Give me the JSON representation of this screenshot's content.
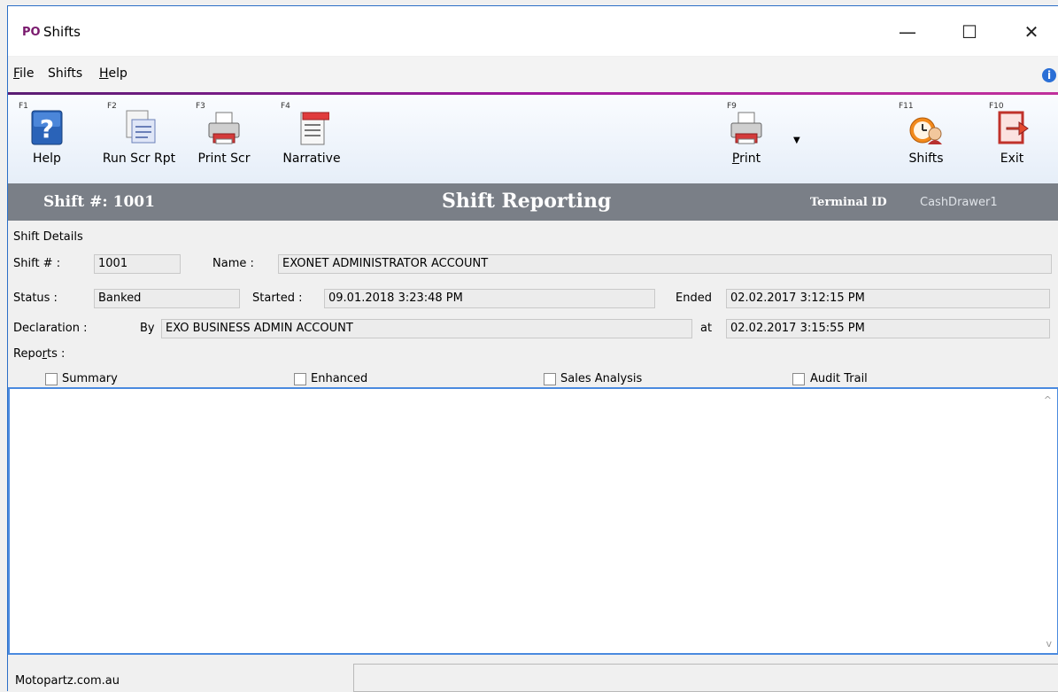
{
  "window": {
    "logo": "PO",
    "title": "Shifts"
  },
  "window_controls": {
    "minimize": "—",
    "maximize": "☐",
    "close": "✕"
  },
  "menu": [
    {
      "label": "File",
      "mnemonic": "F",
      "rest": "ile"
    },
    {
      "label": "Shifts",
      "mnemonic": "",
      "rest": "Shifts"
    },
    {
      "label": "Help",
      "mnemonic": "H",
      "rest": "elp"
    }
  ],
  "info_icon": "i",
  "toolbar": {
    "help": {
      "fkey": "F1",
      "label": "Help",
      "icon": "help-question-icon"
    },
    "run_scr_rpt": {
      "fkey": "F2",
      "label": "Run Scr Rpt",
      "icon": "report-screen-icon"
    },
    "print_scr": {
      "fkey": "F3",
      "label": "Print Scr",
      "icon": "printer-icon"
    },
    "narrative": {
      "fkey": "F4",
      "label": "Narrative",
      "icon": "narrative-document-icon"
    },
    "print": {
      "fkey": "F9",
      "label": "Print",
      "mnemonic": "P",
      "rest": "rint",
      "icon": "printer-icon"
    },
    "shifts": {
      "fkey": "F11",
      "label": "Shifts",
      "icon": "clock-person-icon"
    },
    "exit": {
      "fkey": "F10",
      "label": "Exit",
      "icon": "exit-door-icon"
    }
  },
  "banner": {
    "shift": "Shift #: 1001",
    "title": "Shift Reporting",
    "terminal_label": "Terminal ID",
    "terminal_value": "CashDrawer1"
  },
  "details": {
    "section_title": "Shift Details",
    "shift_label": "Shift # :",
    "shift_value": "1001",
    "name_label": "Name :",
    "name_value": "EXONET ADMINISTRATOR ACCOUNT",
    "status_label": "Status :",
    "status_value": "Banked",
    "started_label": "Started :",
    "started_value": "09.01.2018 3:23:48 PM",
    "ended_label": "Ended",
    "ended_value": "02.02.2017 3:12:15 PM",
    "declaration_label": "Declaration :",
    "by_label": "By",
    "by_value": "EXO BUSINESS ADMIN ACCOUNT",
    "at_label": "at",
    "at_value": "02.02.2017 3:15:55 PM",
    "reports_label_pre": "Repo",
    "reports_label_mn": "r",
    "reports_label_post": "ts :",
    "reports": [
      {
        "label": "Summary",
        "checked": false
      },
      {
        "label": "Enhanced",
        "checked": false
      },
      {
        "label": "Sales Analysis",
        "checked": false
      },
      {
        "label": "Audit Trail",
        "checked": false
      }
    ]
  },
  "textarea": {
    "scroll_up": "^",
    "scroll_down": "v"
  },
  "status": {
    "text": "Motopartz.com.au"
  }
}
